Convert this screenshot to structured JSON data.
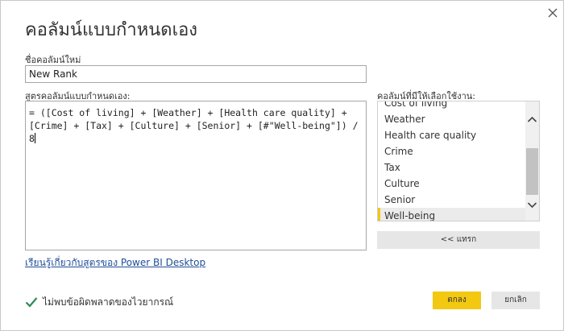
{
  "dialog": {
    "title": "คอลัมน์แบบกำหนดเอง",
    "new_column_name_label": "ชื่อคอลัมน์ใหม่",
    "new_column_name_value": "New Rank",
    "formula_label": "สูตรคอลัมน์แบบกำหนดเอง:",
    "formula_text": "= ([Cost of living] + [Weather] + [Health care quality] +\n[Crime] + [Tax] + [Culture] + [Senior] + [#\"Well-being\"]) / 8",
    "available_columns_label": "คอลัมน์ที่มีให้เลือกใช้งาน:",
    "available_columns": [
      "Cost of living",
      "Weather",
      "Health care quality",
      "Crime",
      "Tax",
      "Culture",
      "Senior",
      "Well-being"
    ],
    "selected_column": "Well-being",
    "insert_button": "<< แทรก",
    "help_link": "เรียนรู้เกี่ยวกับสูตรของ Power BI Desktop",
    "status_text": "ไม่พบข้อผิดพลาดของไวยากรณ์",
    "ok_button": "ตกลง",
    "cancel_button": "ยกเลิก"
  },
  "colors": {
    "accent": "#f2c811",
    "link": "#1f4e99",
    "success": "#2e8b57"
  },
  "icons": {
    "close": "close-icon",
    "check": "checkmark-icon",
    "scroll_up": "chevron-up-icon",
    "scroll_down": "chevron-down-icon"
  }
}
